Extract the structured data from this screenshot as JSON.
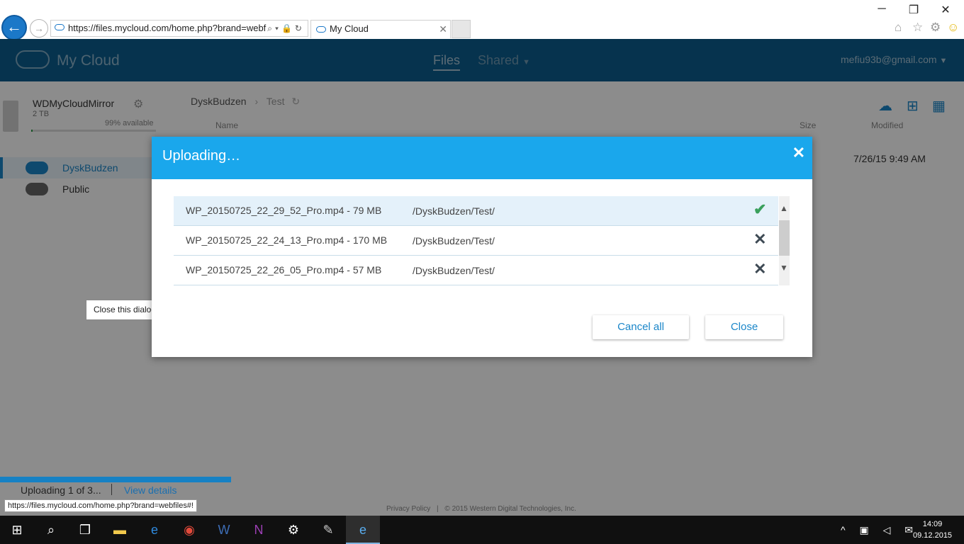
{
  "browser": {
    "url": "https://files.mycloud.com/home.php?brand=webf",
    "tab_title": "My Cloud",
    "status_url": "https://files.mycloud.com/home.php?brand=webfiles#!"
  },
  "app": {
    "logo": "My Cloud",
    "nav_files": "Files",
    "nav_shared": "Shared",
    "user": "mefiu93b@gmail.com"
  },
  "device": {
    "name": "WDMyCloudMirror",
    "capacity": "2 TB",
    "available": "99% available",
    "available_fraction": 0.99
  },
  "sidebar": {
    "items": [
      {
        "label": "DyskBudzen"
      },
      {
        "label": "Public"
      }
    ]
  },
  "breadcrumb": {
    "root": "DyskBudzen",
    "current": "Test"
  },
  "table": {
    "col_name": "Name",
    "col_size": "Size",
    "col_modified": "Modified",
    "row_modified": "7/26/15 9:49 AM"
  },
  "footer": {
    "privacy": "Privacy Policy",
    "copyright": "© 2015 Western Digital Technologies, Inc."
  },
  "upload_bar": {
    "text": "Uploading 1 of 3...",
    "link": "View details",
    "progress": 0.24
  },
  "tooltip": "Close this dialog",
  "dialog": {
    "title": "Uploading…",
    "files": [
      {
        "name": "WP_20150725_22_29_52_Pro.mp4 - 79 MB",
        "path": "/DyskBudzen/Test/",
        "status": "done"
      },
      {
        "name": "WP_20150725_22_24_13_Pro.mp4 - 170 MB",
        "path": "/DyskBudzen/Test/",
        "status": "cancel"
      },
      {
        "name": "WP_20150725_22_26_05_Pro.mp4 - 57 MB",
        "path": "/DyskBudzen/Test/",
        "status": "cancel"
      }
    ],
    "cancel_all": "Cancel all",
    "close": "Close"
  },
  "taskbar": {
    "time": "14:09",
    "date": "09.12.2015"
  },
  "colors": {
    "dialog_header": "#1aa7ec",
    "accent": "#1a86c9",
    "success": "#3aa05c"
  }
}
